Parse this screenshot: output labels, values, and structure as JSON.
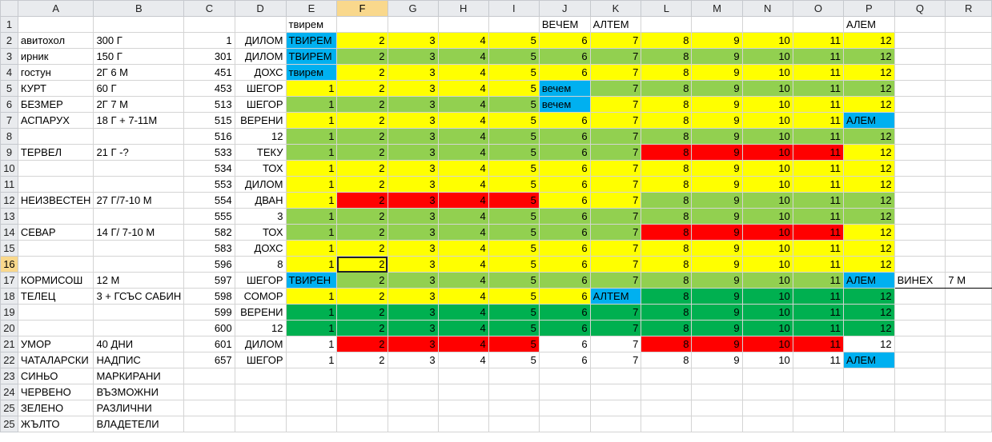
{
  "columns": [
    "A",
    "B",
    "C",
    "D",
    "E",
    "F",
    "G",
    "H",
    "I",
    "J",
    "K",
    "L",
    "M",
    "N",
    "O",
    "P",
    "Q",
    "R"
  ],
  "rows": [
    {
      "n": "1",
      "a": "",
      "b": "",
      "c": "",
      "d": "",
      "e": "твирем",
      "ec": "w",
      "v": [
        "",
        "",
        "",
        "",
        ""
      ],
      "vc": [
        "w",
        "w",
        "w",
        "w",
        "w"
      ],
      "j": "ВЕЧЕМ",
      "jc": "w",
      "k": "АЛТЕМ",
      "kc": "w",
      "l": "",
      "m": "",
      "nn": "",
      "o": "",
      "lc": [
        "w",
        "w",
        "w",
        "w"
      ],
      "p": "АЛЕМ",
      "pc": "w",
      "q": "",
      "r": ""
    },
    {
      "n": "2",
      "a": "авитохол",
      "b": "300 Г",
      "c": "1",
      "d": "ДИЛОМ",
      "e": "ТВИРЕМ",
      "ec": "b",
      "v": [
        "2",
        "3",
        "4",
        "5",
        "6"
      ],
      "vc": [
        "y",
        "y",
        "y",
        "y",
        "y"
      ],
      "k": "7",
      "kc": "y",
      "l": "8",
      "m": "9",
      "nn": "10",
      "o": "11",
      "lc": [
        "y",
        "y",
        "y",
        "y"
      ],
      "p": "12",
      "pc": "y",
      "q": "",
      "r": ""
    },
    {
      "n": "3",
      "a": "ирник",
      "b": "150 Г",
      "c": "301",
      "d": "ДИЛОМ",
      "e": "ТВИРЕМ",
      "ec": "b",
      "v": [
        "2",
        "3",
        "4",
        "5",
        "6"
      ],
      "vc": [
        "g",
        "g",
        "g",
        "g",
        "g"
      ],
      "k": "7",
      "kc": "g",
      "l": "8",
      "m": "9",
      "nn": "10",
      "o": "11",
      "lc": [
        "g",
        "g",
        "g",
        "g"
      ],
      "p": "12",
      "pc": "g",
      "q": "",
      "r": ""
    },
    {
      "n": "4",
      "a": "гостун",
      "b": "2Г 6 М",
      "c": "451",
      "d": "ДОХС",
      "e": "твирем",
      "ec": "b",
      "v": [
        "2",
        "3",
        "4",
        "5",
        "6"
      ],
      "vc": [
        "y",
        "y",
        "y",
        "y",
        "y"
      ],
      "k": "7",
      "kc": "y",
      "l": "8",
      "m": "9",
      "nn": "10",
      "o": "11",
      "lc": [
        "y",
        "y",
        "y",
        "y"
      ],
      "p": "12",
      "pc": "y",
      "q": "",
      "r": ""
    },
    {
      "n": "5",
      "a": "КУРТ",
      "b": "60 Г",
      "c": "453",
      "d": "ШЕГОР",
      "e": "1",
      "ec": "y",
      "v": [
        "2",
        "3",
        "4",
        "5",
        "вечем"
      ],
      "vc": [
        "y",
        "y",
        "y",
        "y",
        "b"
      ],
      "k": "7",
      "kc": "g",
      "l": "8",
      "m": "9",
      "nn": "10",
      "o": "11",
      "lc": [
        "g",
        "g",
        "g",
        "g"
      ],
      "p": "12",
      "pc": "g",
      "q": "",
      "r": ""
    },
    {
      "n": "6",
      "a": "БЕЗМЕР",
      "b": "2Г 7 М",
      "c": "513",
      "d": "ШЕГОР",
      "e": "1",
      "ec": "g",
      "v": [
        "2",
        "3",
        "4",
        "5",
        "вечем"
      ],
      "vc": [
        "g",
        "g",
        "g",
        "g",
        "b"
      ],
      "k": "7",
      "kc": "y",
      "l": "8",
      "m": "9",
      "nn": "10",
      "o": "11",
      "lc": [
        "y",
        "y",
        "y",
        "y"
      ],
      "p": "12",
      "pc": "y",
      "q": "",
      "r": ""
    },
    {
      "n": "7",
      "a": "АСПАРУХ",
      "b": "18 Г + 7-11М",
      "c": "515",
      "d": "ВЕРЕНИ",
      "e": "1",
      "ec": "y",
      "v": [
        "2",
        "3",
        "4",
        "5",
        "6"
      ],
      "vc": [
        "y",
        "y",
        "y",
        "y",
        "y"
      ],
      "k": "7",
      "kc": "y",
      "l": "8",
      "m": "9",
      "nn": "10",
      "o": "11",
      "lc": [
        "y",
        "y",
        "y",
        "y"
      ],
      "p": "АЛЕМ",
      "pc": "b",
      "q": "",
      "r": ""
    },
    {
      "n": "8",
      "a": "",
      "b": "",
      "c": "516",
      "d": "12",
      "e": "1",
      "ec": "g",
      "v": [
        "2",
        "3",
        "4",
        "5",
        "6"
      ],
      "vc": [
        "g",
        "g",
        "g",
        "g",
        "g"
      ],
      "k": "7",
      "kc": "g",
      "l": "8",
      "m": "9",
      "nn": "10",
      "o": "11",
      "lc": [
        "g",
        "g",
        "g",
        "g"
      ],
      "p": "12",
      "pc": "g",
      "q": "",
      "r": ""
    },
    {
      "n": "9",
      "a": "ТЕРВЕЛ",
      "b": "21 Г -?",
      "c": "533",
      "d": "ТЕКУ",
      "e": "1",
      "ec": "g",
      "v": [
        "2",
        "3",
        "4",
        "5",
        "6"
      ],
      "vc": [
        "g",
        "g",
        "g",
        "g",
        "g"
      ],
      "k": "7",
      "kc": "g",
      "l": "8",
      "m": "9",
      "nn": "10",
      "o": "11",
      "lc": [
        "r",
        "r",
        "r",
        "r"
      ],
      "p": "12",
      "pc": "y",
      "q": "",
      "r": ""
    },
    {
      "n": "10",
      "a": "",
      "b": "",
      "c": "534",
      "d": "ТОХ",
      "e": "1",
      "ec": "y",
      "v": [
        "2",
        "3",
        "4",
        "5",
        "6"
      ],
      "vc": [
        "y",
        "y",
        "y",
        "y",
        "y"
      ],
      "k": "7",
      "kc": "y",
      "l": "8",
      "m": "9",
      "nn": "10",
      "o": "11",
      "lc": [
        "y",
        "y",
        "y",
        "y"
      ],
      "p": "12",
      "pc": "y",
      "q": "",
      "r": ""
    },
    {
      "n": "11",
      "a": "",
      "b": "",
      "c": "553",
      "d": "ДИЛОМ",
      "e": "1",
      "ec": "y",
      "v": [
        "2",
        "3",
        "4",
        "5",
        "6"
      ],
      "vc": [
        "y",
        "y",
        "y",
        "y",
        "y"
      ],
      "k": "7",
      "kc": "y",
      "l": "8",
      "m": "9",
      "nn": "10",
      "o": "11",
      "lc": [
        "y",
        "y",
        "y",
        "y"
      ],
      "p": "12",
      "pc": "y",
      "q": "",
      "r": ""
    },
    {
      "n": "12",
      "a": "НЕИЗВЕСТЕН",
      "b": "27 Г/7-10 М",
      "c": "554",
      "d": "ДВАН",
      "e": "1",
      "ec": "y",
      "v": [
        "2",
        "3",
        "4",
        "5",
        "6"
      ],
      "vc": [
        "r",
        "r",
        "r",
        "r",
        "y"
      ],
      "k": "7",
      "kc": "y",
      "l": "8",
      "m": "9",
      "nn": "10",
      "o": "11",
      "lc": [
        "g",
        "g",
        "g",
        "g"
      ],
      "p": "12",
      "pc": "g",
      "q": "",
      "r": ""
    },
    {
      "n": "13",
      "a": "",
      "b": "",
      "c": "555",
      "d": "3",
      "e": "1",
      "ec": "g",
      "v": [
        "2",
        "3",
        "4",
        "5",
        "6"
      ],
      "vc": [
        "g",
        "g",
        "g",
        "g",
        "g"
      ],
      "k": "7",
      "kc": "g",
      "l": "8",
      "m": "9",
      "nn": "10",
      "o": "11",
      "lc": [
        "g",
        "g",
        "g",
        "g"
      ],
      "p": "12",
      "pc": "g",
      "q": "",
      "r": ""
    },
    {
      "n": "14",
      "a": "СЕВАР",
      "b": "14 Г/ 7-10 М",
      "c": "582",
      "d": "ТОХ",
      "e": "1",
      "ec": "g",
      "v": [
        "2",
        "3",
        "4",
        "5",
        "6"
      ],
      "vc": [
        "g",
        "g",
        "g",
        "g",
        "g"
      ],
      "k": "7",
      "kc": "g",
      "l": "8",
      "m": "9",
      "nn": "10",
      "o": "11",
      "lc": [
        "r",
        "r",
        "r",
        "r"
      ],
      "p": "12",
      "pc": "y",
      "q": "",
      "r": ""
    },
    {
      "n": "15",
      "a": "",
      "b": "",
      "c": "583",
      "d": "ДОХС",
      "e": "1",
      "ec": "y",
      "v": [
        "2",
        "3",
        "4",
        "5",
        "6"
      ],
      "vc": [
        "y",
        "y",
        "y",
        "y",
        "y"
      ],
      "k": "7",
      "kc": "y",
      "l": "8",
      "m": "9",
      "nn": "10",
      "o": "11",
      "lc": [
        "y",
        "y",
        "y",
        "y"
      ],
      "p": "12",
      "pc": "y",
      "q": "",
      "r": ""
    },
    {
      "n": "16",
      "a": "",
      "b": "",
      "c": "596",
      "d": "8",
      "e": "1",
      "ec": "y",
      "v": [
        "2",
        "3",
        "4",
        "5",
        "6"
      ],
      "vc": [
        "y",
        "y",
        "y",
        "y",
        "y"
      ],
      "k": "7",
      "kc": "y",
      "l": "8",
      "m": "9",
      "nn": "10",
      "o": "11",
      "lc": [
        "y",
        "y",
        "y",
        "y"
      ],
      "p": "12",
      "pc": "y",
      "q": "",
      "r": ""
    },
    {
      "n": "17",
      "a": "КОРМИСОШ",
      "b": "12 М",
      "c": "597",
      "d": "ШЕГОР",
      "e": "ТВИРЕН",
      "ec": "b",
      "v": [
        "2",
        "3",
        "4",
        "5",
        "6"
      ],
      "vc": [
        "g",
        "g",
        "g",
        "g",
        "g"
      ],
      "k": "7",
      "kc": "g",
      "l": "8",
      "m": "9",
      "nn": "10",
      "o": "11",
      "lc": [
        "g",
        "g",
        "g",
        "g"
      ],
      "p": "АЛЕМ",
      "pc": "b",
      "q": "ВИНЕХ",
      "r": "7 М"
    },
    {
      "n": "18",
      "a": "ТЕЛЕЦ",
      "b": "3 + ГСЪС САБИН",
      "c": "598",
      "d": "СОМОР",
      "e": "1",
      "ec": "y",
      "v": [
        "2",
        "3",
        "4",
        "5",
        "6"
      ],
      "vc": [
        "y",
        "y",
        "y",
        "y",
        "y"
      ],
      "k": "АЛТЕМ",
      "kc": "b",
      "l": "8",
      "m": "9",
      "nn": "10",
      "o": "11",
      "lc": [
        "dg",
        "dg",
        "dg",
        "dg"
      ],
      "p": "12",
      "pc": "dg",
      "q": "",
      "r": ""
    },
    {
      "n": "19",
      "a": "",
      "b": "",
      "c": "599",
      "d": "ВЕРЕНИ",
      "e": "1",
      "ec": "dg",
      "v": [
        "2",
        "3",
        "4",
        "5",
        "6"
      ],
      "vc": [
        "dg",
        "dg",
        "dg",
        "dg",
        "dg"
      ],
      "k": "7",
      "kc": "dg",
      "l": "8",
      "m": "9",
      "nn": "10",
      "o": "11",
      "lc": [
        "dg",
        "dg",
        "dg",
        "dg"
      ],
      "p": "12",
      "pc": "dg",
      "q": "",
      "r": ""
    },
    {
      "n": "20",
      "a": "",
      "b": "",
      "c": "600",
      "d": "12",
      "e": "1",
      "ec": "dg",
      "v": [
        "2",
        "3",
        "4",
        "5",
        "6"
      ],
      "vc": [
        "dg",
        "dg",
        "dg",
        "dg",
        "dg"
      ],
      "k": "7",
      "kc": "dg",
      "l": "8",
      "m": "9",
      "nn": "10",
      "o": "11",
      "lc": [
        "dg",
        "dg",
        "dg",
        "dg"
      ],
      "p": "12",
      "pc": "dg",
      "q": "",
      "r": ""
    },
    {
      "n": "21",
      "a": "УМОР",
      "b": "40 ДНИ",
      "c": "601",
      "d": "ДИЛОМ",
      "e": "1",
      "ec": "w",
      "v": [
        "2",
        "3",
        "4",
        "5",
        "6"
      ],
      "vc": [
        "r",
        "r",
        "r",
        "r",
        "w"
      ],
      "k": "7",
      "kc": "w",
      "l": "8",
      "m": "9",
      "nn": "10",
      "o": "11",
      "lc": [
        "r",
        "r",
        "r",
        "r"
      ],
      "p": "12",
      "pc": "w",
      "q": "",
      "r": ""
    },
    {
      "n": "22",
      "a": "ЧАТАЛАРСКИ",
      "b": "НАДПИС",
      "c": "657",
      "d": "ШЕГОР",
      "e": "1",
      "ec": "w",
      "v": [
        "2",
        "3",
        "4",
        "5",
        "6"
      ],
      "vc": [
        "w",
        "w",
        "w",
        "w",
        "w"
      ],
      "k": "7",
      "kc": "w",
      "l": "8",
      "m": "9",
      "nn": "10",
      "o": "11",
      "lc": [
        "w",
        "w",
        "w",
        "w"
      ],
      "p": "АЛЕМ",
      "pc": "b",
      "q": "",
      "r": ""
    },
    {
      "n": "23",
      "a": "СИНЬО",
      "b": "МАРКИРАНИ",
      "c": "",
      "d": "",
      "e": "",
      "ec": "w",
      "v": [
        "",
        "",
        "",
        "",
        ""
      ],
      "vc": [
        "w",
        "w",
        "w",
        "w",
        "w"
      ],
      "k": "",
      "kc": "w",
      "l": "",
      "m": "",
      "nn": "",
      "o": "",
      "lc": [
        "w",
        "w",
        "w",
        "w"
      ],
      "p": "",
      "pc": "w",
      "q": "",
      "r": ""
    },
    {
      "n": "24",
      "a": "ЧЕРВЕНО",
      "b": "ВЪЗМОЖНИ",
      "c": "",
      "d": "",
      "e": "",
      "ec": "w",
      "v": [
        "",
        "",
        "",
        "",
        ""
      ],
      "vc": [
        "w",
        "w",
        "w",
        "w",
        "w"
      ],
      "k": "",
      "kc": "w",
      "l": "",
      "m": "",
      "nn": "",
      "o": "",
      "lc": [
        "w",
        "w",
        "w",
        "w"
      ],
      "p": "",
      "pc": "w",
      "q": "",
      "r": ""
    },
    {
      "n": "25",
      "a": "ЗЕЛЕНО",
      "b": "РАЗЛИЧНИ",
      "c": "",
      "d": "",
      "e": "",
      "ec": "w",
      "v": [
        "",
        "",
        "",
        "",
        ""
      ],
      "vc": [
        "w",
        "w",
        "w",
        "w",
        "w"
      ],
      "k": "",
      "kc": "w",
      "l": "",
      "m": "",
      "nn": "",
      "o": "",
      "lc": [
        "w",
        "w",
        "w",
        "w"
      ],
      "p": "",
      "pc": "w",
      "q": "",
      "r": ""
    },
    {
      "n": "25",
      "a": "ЖЪЛТО",
      "b": "ВЛАДЕТЕЛИ",
      "c": "",
      "d": "",
      "e": "",
      "ec": "w",
      "v": [
        "",
        "",
        "",
        "",
        ""
      ],
      "vc": [
        "w",
        "w",
        "w",
        "w",
        "w"
      ],
      "k": "",
      "kc": "w",
      "l": "",
      "m": "",
      "nn": "",
      "o": "",
      "lc": [
        "w",
        "w",
        "w",
        "w"
      ],
      "p": "",
      "pc": "w",
      "q": "",
      "r": ""
    }
  ],
  "selection": {
    "row": "16",
    "col": "F"
  },
  "colors": {
    "yellow": "#ffff00",
    "light_green": "#92d050",
    "dark_green": "#00b050",
    "red": "#ff0000",
    "blue": "#00b0f0"
  }
}
